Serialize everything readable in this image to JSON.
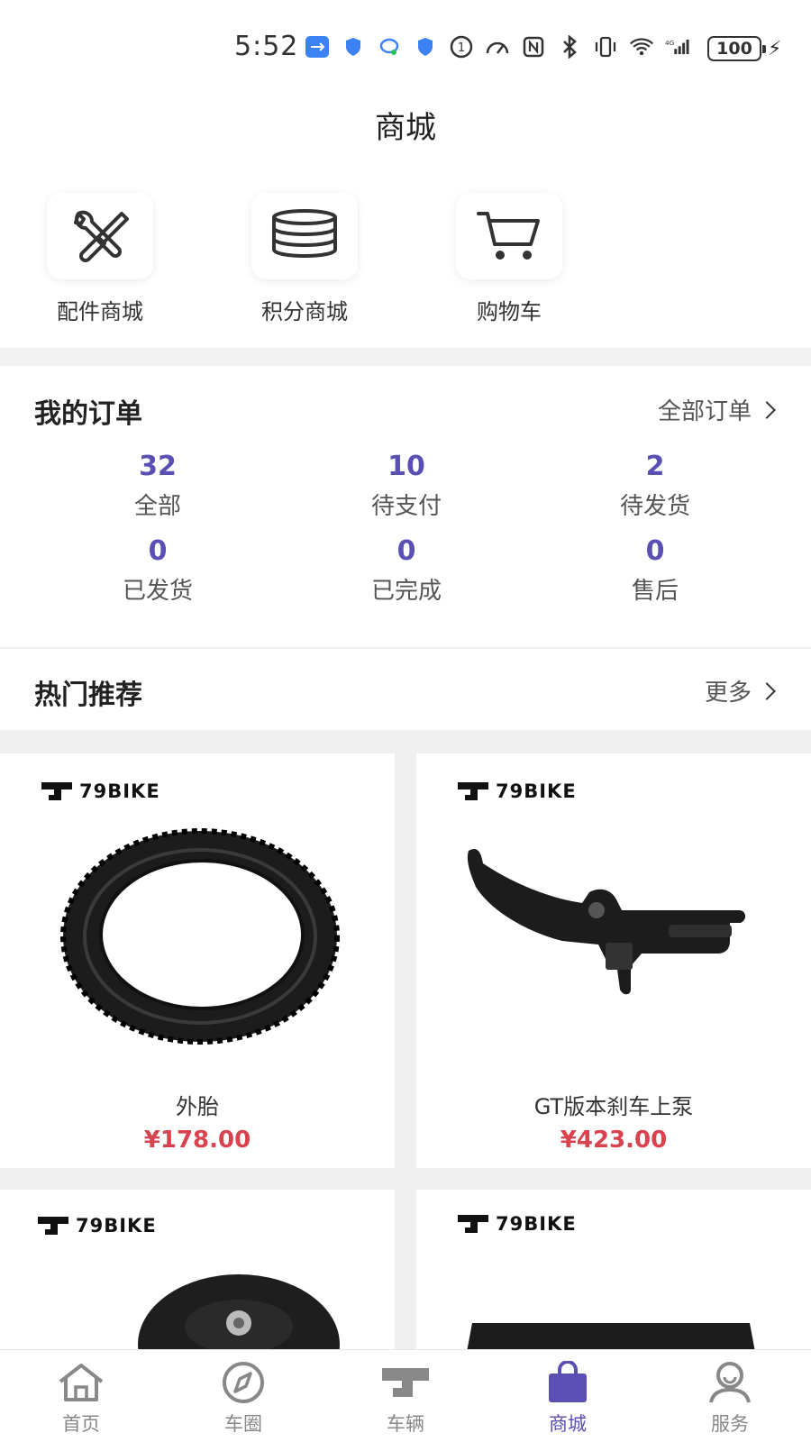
{
  "status_bar": {
    "time": "5:52",
    "battery": "100",
    "icons": [
      "usb-icon",
      "shield-icon",
      "sync-icon",
      "shield-icon",
      "data-icon",
      "speed-icon",
      "nfc-icon",
      "bluetooth-icon",
      "vibrate-icon",
      "wifi-icon",
      "signal-4g-icon"
    ]
  },
  "header": {
    "title": "商城"
  },
  "quick_entries": [
    {
      "label": "配件商城",
      "icon": "tools-icon"
    },
    {
      "label": "积分商城",
      "icon": "coins-icon"
    },
    {
      "label": "购物车",
      "icon": "cart-icon"
    }
  ],
  "orders": {
    "title": "我的订单",
    "link": "全部订单",
    "stats": [
      {
        "count": "32",
        "label": "全部"
      },
      {
        "count": "10",
        "label": "待支付"
      },
      {
        "count": "2",
        "label": "待发货"
      },
      {
        "count": "0",
        "label": "已发货"
      },
      {
        "count": "0",
        "label": "已完成"
      },
      {
        "count": "0",
        "label": "售后"
      }
    ]
  },
  "recommend": {
    "title": "热门推荐",
    "link": "更多",
    "brand": "79BIKE",
    "products": [
      {
        "name": "外胎",
        "price": "¥178.00",
        "image": "tire-image"
      },
      {
        "name": "GT版本刹车上泵",
        "price": "¥423.00",
        "image": "brake-lever-image"
      },
      {
        "name": "",
        "price": "",
        "image": "motor-hub-image"
      },
      {
        "name": "",
        "price": "",
        "image": "display-panel-image"
      }
    ]
  },
  "tabbar": {
    "items": [
      {
        "label": "首页",
        "icon": "home-icon"
      },
      {
        "label": "车圈",
        "icon": "compass-icon"
      },
      {
        "label": "车辆",
        "icon": "bike-logo-icon"
      },
      {
        "label": "商城",
        "icon": "shopping-bag-icon"
      },
      {
        "label": "服务",
        "icon": "user-service-icon"
      }
    ],
    "active": "商城",
    "active_color": "#5b4fb3",
    "price_color": "#d9424f"
  }
}
